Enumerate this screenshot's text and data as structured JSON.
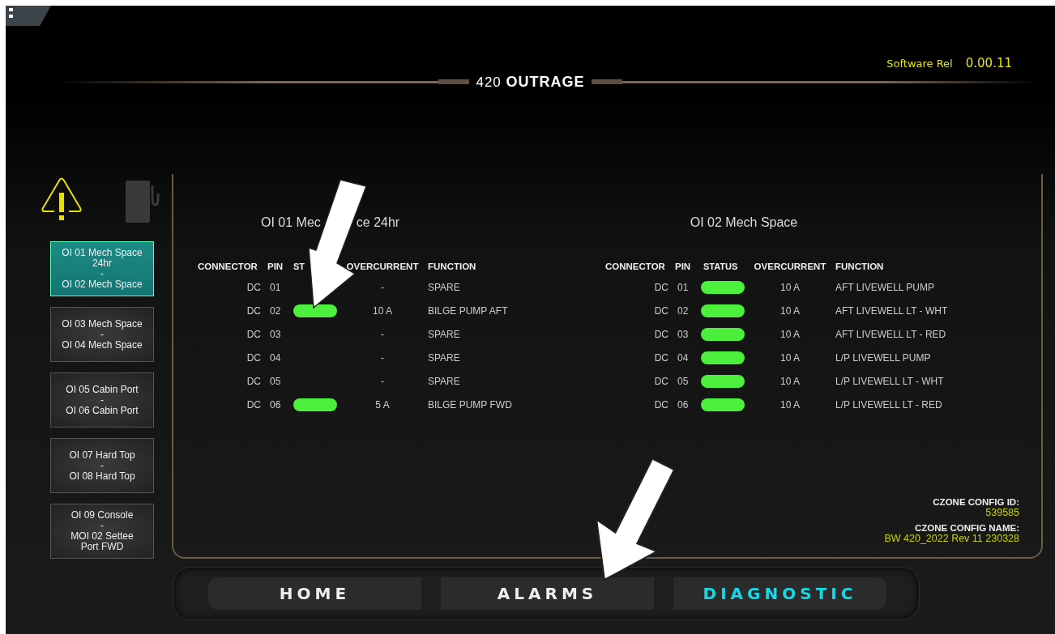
{
  "header": {
    "title": "420 **OUTRAGE**",
    "software_label": "Software Rel",
    "software_version": "0.00.11"
  },
  "sidebar": {
    "items": [
      {
        "lines": [
          "OI 01 Mech Space",
          "24hr",
          "-",
          "OI 02 Mech Space"
        ],
        "selected": true
      },
      {
        "lines": [
          "OI 03 Mech Space",
          "-",
          "OI 04 Mech Space"
        ],
        "selected": false
      },
      {
        "lines": [
          "OI 05 Cabin Port",
          "-",
          "OI 06 Cabin Port"
        ],
        "selected": false
      },
      {
        "lines": [
          "OI 07 Hard Top",
          "-",
          "OI 08 Hard Top"
        ],
        "selected": false
      },
      {
        "lines": [
          "OI 09 Console",
          "-",
          "MOI 02 Settee",
          "Port FWD"
        ],
        "selected": false
      }
    ]
  },
  "modules": [
    {
      "heading": [
        "OI 01 Mec",
        "ce 24hr"
      ],
      "columns": [
        "CONNECTOR",
        "PIN",
        "ST",
        "OVERCURRENT",
        "FUNCTION"
      ],
      "rows": [
        {
          "connector": "DC",
          "pin": "01",
          "on": false,
          "overcurrent": "-",
          "function": "SPARE"
        },
        {
          "connector": "DC",
          "pin": "02",
          "on": true,
          "overcurrent": "10 A",
          "function": "BILGE PUMP AFT"
        },
        {
          "connector": "DC",
          "pin": "03",
          "on": false,
          "overcurrent": "-",
          "function": "SPARE"
        },
        {
          "connector": "DC",
          "pin": "04",
          "on": false,
          "overcurrent": "-",
          "function": "SPARE"
        },
        {
          "connector": "DC",
          "pin": "05",
          "on": false,
          "overcurrent": "-",
          "function": "SPARE"
        },
        {
          "connector": "DC",
          "pin": "06",
          "on": true,
          "overcurrent": "5 A",
          "function": "BILGE PUMP FWD"
        }
      ]
    },
    {
      "heading": [
        "OI 02 Mech Space"
      ],
      "columns": [
        "CONNECTOR",
        "PIN",
        "STATUS",
        "OVERCURRENT",
        "FUNCTION"
      ],
      "rows": [
        {
          "connector": "DC",
          "pin": "01",
          "on": true,
          "overcurrent": "10 A",
          "function": "AFT LIVEWELL PUMP"
        },
        {
          "connector": "DC",
          "pin": "02",
          "on": true,
          "overcurrent": "10 A",
          "function": "AFT LIVEWELL LT - WHT"
        },
        {
          "connector": "DC",
          "pin": "03",
          "on": true,
          "overcurrent": "10 A",
          "function": "AFT LIVEWELL LT - RED"
        },
        {
          "connector": "DC",
          "pin": "04",
          "on": true,
          "overcurrent": "10 A",
          "function": "L/P LIVEWELL PUMP"
        },
        {
          "connector": "DC",
          "pin": "05",
          "on": true,
          "overcurrent": "10 A",
          "function": "L/P LIVEWELL LT - WHT"
        },
        {
          "connector": "DC",
          "pin": "06",
          "on": true,
          "overcurrent": "10 A",
          "function": "L/P LIVEWELL LT - RED"
        }
      ]
    }
  ],
  "config": {
    "id_label": "CZONE CONFIG ID:",
    "id": "539585",
    "name_label": "CZONE CONFIG NAME:",
    "name": "BW 420_2022 Rev 11 230328"
  },
  "nav": [
    {
      "label": "HOME",
      "selected": false
    },
    {
      "label": "ALARMS",
      "selected": false
    },
    {
      "label": "DIAGNOSTIC",
      "selected": true
    }
  ]
}
